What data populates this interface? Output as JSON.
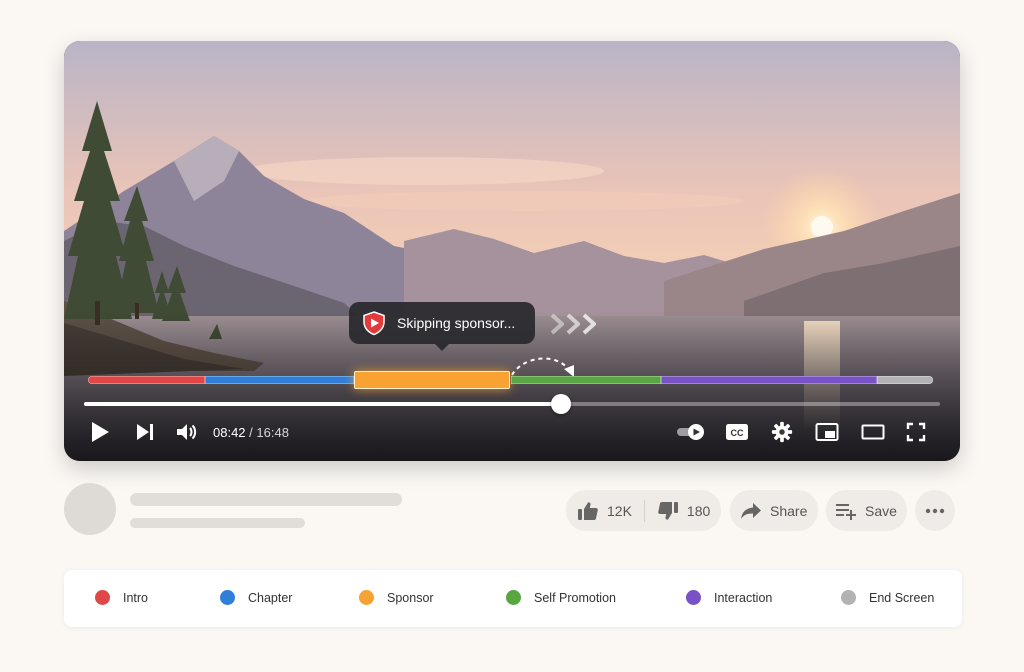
{
  "player": {
    "tooltip": {
      "text": "Skipping sponsor..."
    },
    "segments": [
      {
        "category": "Intro",
        "color": "#e04848",
        "start": 0.0,
        "end": 0.138
      },
      {
        "category": "Chapter",
        "color": "#2f7fd9",
        "start": 0.138,
        "end": 0.315
      },
      {
        "category": "Sponsor",
        "color": "#f7a233",
        "start": 0.315,
        "end": 0.5
      },
      {
        "category": "Self Promotion",
        "color": "#58a642",
        "start": 0.5,
        "end": 0.678
      },
      {
        "category": "Interaction",
        "color": "#7a52c7",
        "start": 0.678,
        "end": 0.934
      },
      {
        "category": "End Screen",
        "color": "#b3b3b3",
        "start": 0.934,
        "end": 1.0
      }
    ],
    "progress": {
      "fraction": 0.557
    },
    "time": {
      "current": "08:42",
      "separator": " / ",
      "duration": "16:48"
    },
    "controls": {
      "left": [
        "play-icon",
        "next-icon",
        "volume-icon"
      ],
      "right": [
        "autoplay-toggle-icon",
        "captions-icon",
        "settings-icon",
        "miniplayer-icon",
        "theater-icon",
        "fullscreen-icon"
      ]
    }
  },
  "actions": {
    "likes": "12K",
    "dislikes": "180",
    "share_label": "Share",
    "save_label": "Save",
    "more_icon": "more-horizontal-icon"
  },
  "legend": [
    {
      "label": "Intro",
      "color": "#e04848"
    },
    {
      "label": "Chapter",
      "color": "#2f7fd9"
    },
    {
      "label": "Sponsor",
      "color": "#f7a233"
    },
    {
      "label": "Self Promotion",
      "color": "#58a642"
    },
    {
      "label": "Interaction",
      "color": "#7a52c7"
    },
    {
      "label": "End Screen",
      "color": "#b3b3b3"
    }
  ]
}
